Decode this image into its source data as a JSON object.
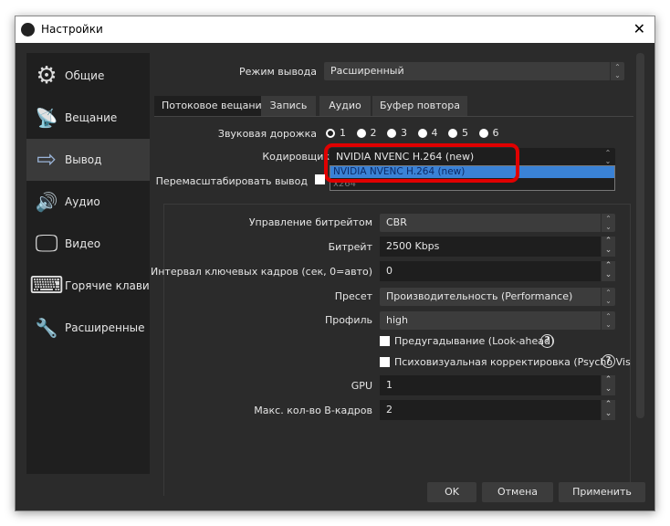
{
  "window": {
    "title": "Настройки",
    "close": "✕"
  },
  "sidebar": {
    "items": [
      {
        "label": "Общие",
        "icon": "⚙"
      },
      {
        "label": "Вещание",
        "icon": "📡"
      },
      {
        "label": "Вывод",
        "icon": "⇨"
      },
      {
        "label": "Аудио",
        "icon": "🔊"
      },
      {
        "label": "Видео",
        "icon": "🖵"
      },
      {
        "label": "Горячие клавиш",
        "icon": "⌨"
      },
      {
        "label": "Расширенные",
        "icon": "🔧"
      }
    ]
  },
  "output_mode": {
    "label": "Режим вывода",
    "value": "Расширенный"
  },
  "tabs": [
    "Потоковое вещание",
    "Запись",
    "Аудио",
    "Буфер повтора"
  ],
  "audio_track": {
    "label": "Звуковая дорожка",
    "options": [
      "1",
      "2",
      "3",
      "4",
      "5",
      "6"
    ],
    "selected": "1"
  },
  "encoder": {
    "label": "Кодировщик",
    "value": "NVIDIA NVENC H.264 (new)",
    "options": [
      "NVIDIA NVENC H.264 (new)",
      "x264"
    ]
  },
  "rescale": {
    "label": "Перемасштабировать вывод"
  },
  "settings": {
    "rate_control": {
      "label": "Управление битрейтом",
      "value": "CBR"
    },
    "bitrate": {
      "label": "Битрейт",
      "value": "2500 Kbps"
    },
    "keyframe": {
      "label": "Интервал ключевых кадров (сек, 0=авто)",
      "value": "0"
    },
    "preset": {
      "label": "Пресет",
      "value": "Производительность (Performance)"
    },
    "profile": {
      "label": "Профиль",
      "value": "high"
    },
    "lookahead": {
      "label": "Предугадывание (Look-ahead)"
    },
    "psycho": {
      "label": "Психовизуальная корректировка (Psycho Vis"
    },
    "gpu": {
      "label": "GPU",
      "value": "1"
    },
    "bframes": {
      "label": "Макс. кол-во B-кадров",
      "value": "2"
    }
  },
  "buttons": {
    "ok": "OK",
    "cancel": "Отмена",
    "apply": "Применить"
  },
  "colors": {
    "highlight": "#3a82d6",
    "annotation": "#e00000"
  }
}
